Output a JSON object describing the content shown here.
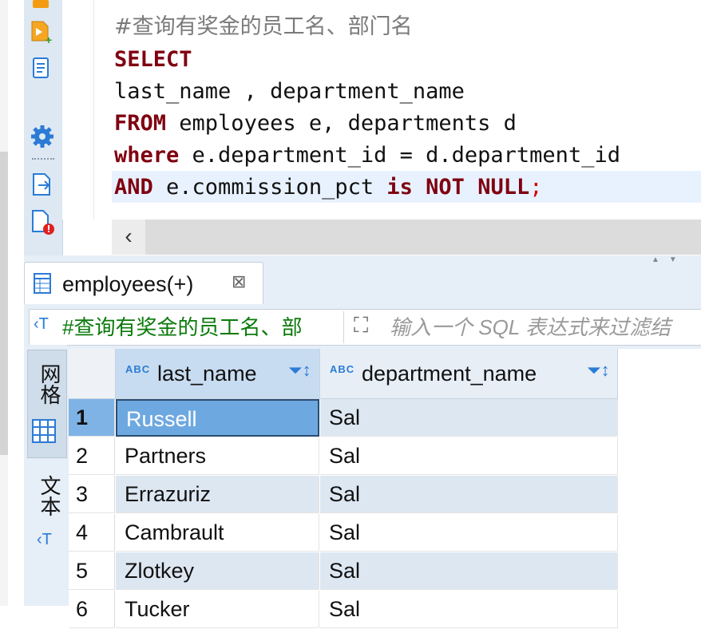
{
  "editor": {
    "comment": "#查询有奖金的员工名、部门名",
    "line2_kw": "SELECT",
    "line3": "last_name , department_name",
    "line4_kw": "FROM",
    "line4_rest": " employees e, departments d",
    "line5_kw": "where",
    "line5_rest": " e.department_id = d.department_id",
    "line6_kw1": "AND",
    "line6_mid": " e.commission_pct ",
    "line6_kw2": "is",
    "line6_sp": " ",
    "line6_kw3": "NOT",
    "line6_sp2": " ",
    "line6_kw4": "NULL",
    "line6_semi": ";"
  },
  "result_tab": {
    "label": "employees(+)",
    "close": "⊠"
  },
  "filter": {
    "query": "#查询有奖金的员工名、部",
    "placeholder": "输入一个 SQL 表达式来过滤结"
  },
  "side_tabs": {
    "grid": "网格",
    "text": "文本"
  },
  "grid": {
    "type_badge": "ABC",
    "columns": [
      "last_name",
      "department_name"
    ],
    "rows": [
      {
        "n": "1",
        "last_name": "Russell",
        "department_name": "Sal"
      },
      {
        "n": "2",
        "last_name": "Partners",
        "department_name": "Sal"
      },
      {
        "n": "3",
        "last_name": "Errazuriz",
        "department_name": "Sal"
      },
      {
        "n": "4",
        "last_name": "Cambrault",
        "department_name": "Sal"
      },
      {
        "n": "5",
        "last_name": "Zlotkey",
        "department_name": "Sal"
      },
      {
        "n": "6",
        "last_name": "Tucker",
        "department_name": "Sal"
      }
    ]
  },
  "colors": {
    "keyword": "#7f0010",
    "selection": "#6ea8e0",
    "accent": "#2b7bd6"
  }
}
